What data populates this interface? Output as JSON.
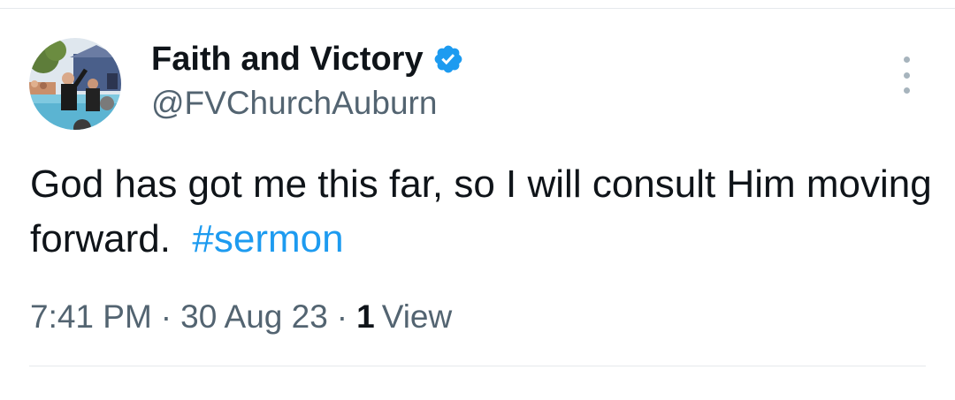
{
  "author": {
    "display_name": "Faith and Victory",
    "handle": "@FVChurchAuburn",
    "verified": true,
    "avatar_icon": "profile-photo"
  },
  "tweet": {
    "text": "God has got me this far, so I will consult Him moving forward.",
    "hashtag": "#sermon"
  },
  "meta": {
    "time": "7:41 PM",
    "date": "30 Aug 23",
    "views_count": "1",
    "views_label": "View",
    "separator": "·"
  },
  "colors": {
    "text_primary": "#0f1419",
    "text_secondary": "#536471",
    "accent_blue": "#1d9bf0",
    "divider": "#e6e9ec"
  },
  "icons": {
    "verified": "verified-badge-icon",
    "more": "more-options-icon"
  }
}
